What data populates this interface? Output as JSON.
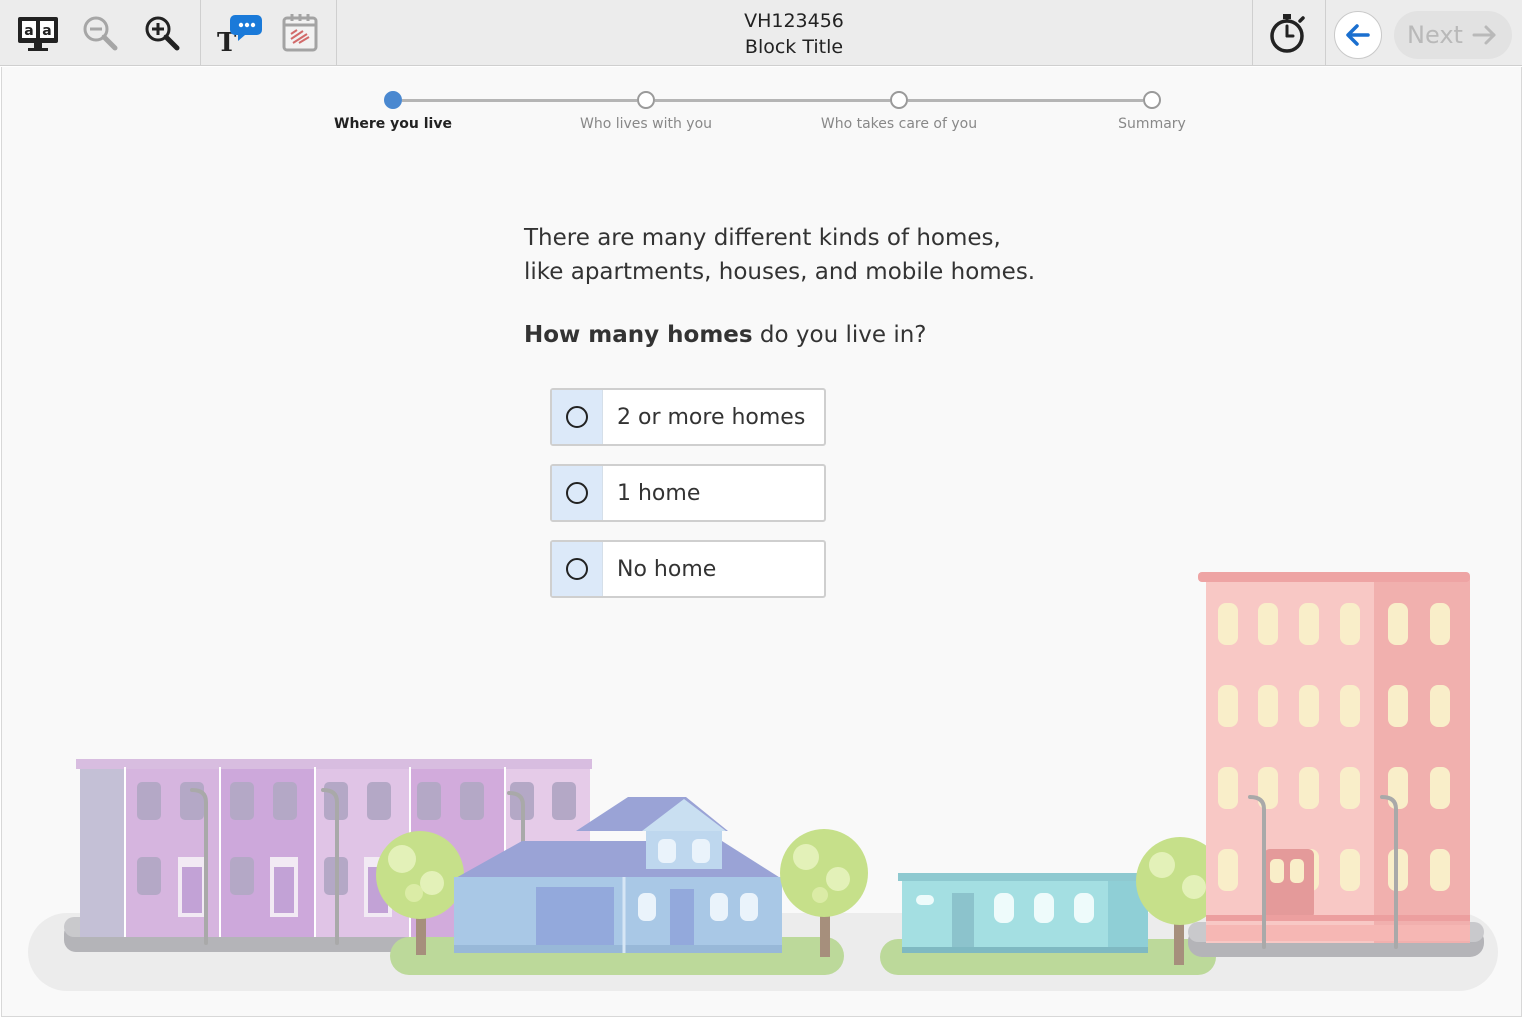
{
  "toolbar": {
    "icons": [
      "translate-icon",
      "zoom-out-icon",
      "zoom-in-icon",
      "text-to-speech-icon",
      "calendar-icon",
      "timer-icon"
    ],
    "case_id": "VH123456",
    "block_title": "Block Title",
    "back_icon": "arrow-left-icon",
    "next_label": "Next"
  },
  "stepper": {
    "steps": [
      {
        "label": "Where you live",
        "active": true
      },
      {
        "label": "Who lives with you",
        "active": false
      },
      {
        "label": "Who takes care of you",
        "active": false
      },
      {
        "label": "Summary",
        "active": false
      }
    ],
    "active_color": "#4a88d0"
  },
  "content": {
    "intro_line1": "There are many different kinds of homes,",
    "intro_line2": "like apartments, houses, and mobile homes.",
    "question_bold": "How many homes",
    "question_rest": " do you live in?"
  },
  "options": [
    {
      "label": "2 or more homes",
      "selected": false
    },
    {
      "label": "1 home",
      "selected": false
    },
    {
      "label": "No home",
      "selected": false
    }
  ],
  "illustration": {
    "type": "neighborhood-scene",
    "colors": {
      "rowhouses": "#d8b8e0",
      "house": "#a9c8e6",
      "mobile_home": "#9fd8dc",
      "apartment": "#f5b5b2",
      "lawn": "#bcd99a",
      "tree": "#cfe69a"
    }
  }
}
